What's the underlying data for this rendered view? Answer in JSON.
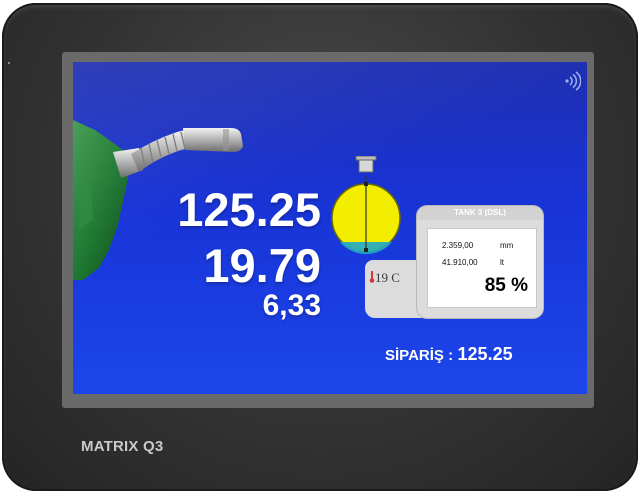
{
  "device": {
    "brand": "MATRIX Q3"
  },
  "display": {
    "amount": "125.25",
    "litres": "19.79",
    "unit_price": "6,33"
  },
  "tank": {
    "title": "TANK 3 (DSL)",
    "level_mm": "2.359,00",
    "level_unit": "mm",
    "volume_lt": "41.910,00",
    "volume_unit": "lt",
    "fill_percent": "85 %",
    "temperature": "19 C"
  },
  "order": {
    "label": "SİPARİŞ :",
    "value": "125.25"
  },
  "icons": {
    "wireless": "wireless-signal-icon",
    "nozzle": "fuel-nozzle-icon",
    "tank": "tank-level-icon",
    "thermometer": "thermometer-icon"
  },
  "colors": {
    "screen": "#1c3ad6",
    "nozzle_handle": "#1e7a32",
    "tank_fill": "#f3ee00",
    "text": "#ffffff"
  }
}
